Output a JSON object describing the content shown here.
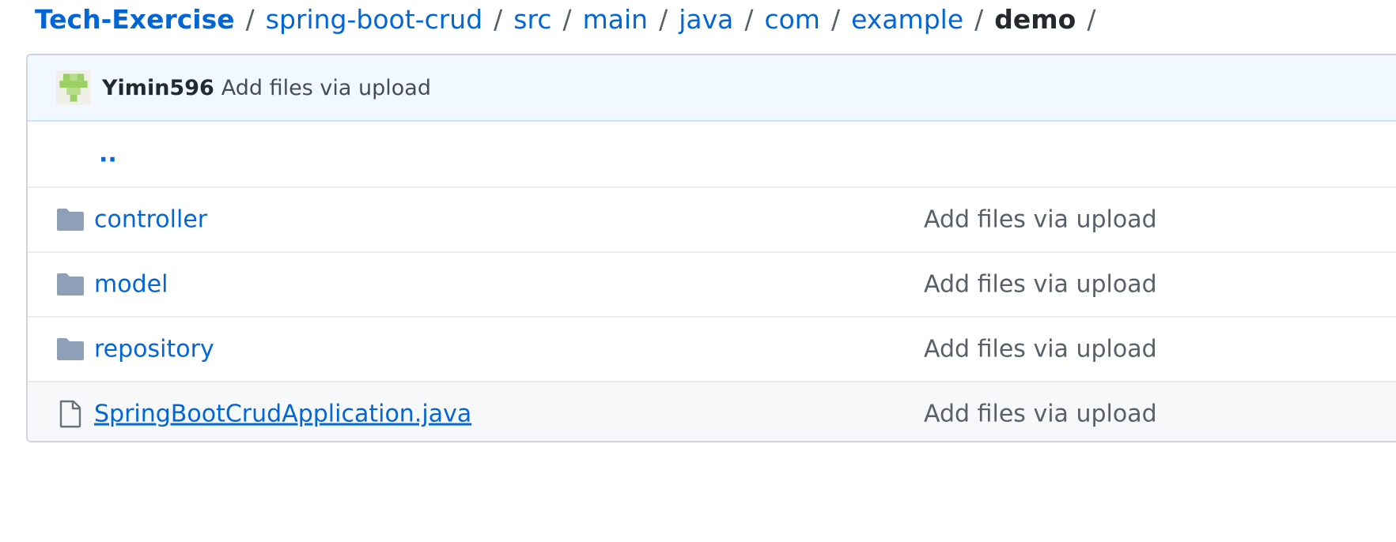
{
  "breadcrumb": {
    "root": "Tech-Exercise",
    "path": [
      "spring-boot-crud",
      "src",
      "main",
      "java",
      "com",
      "example"
    ],
    "current": "demo",
    "separator": "/"
  },
  "commit": {
    "author": "Yimin596",
    "message": "Add files via upload"
  },
  "parent_dir": "..",
  "files": [
    {
      "icon": "folder-icon",
      "name": "controller",
      "message": "Add files via upload"
    },
    {
      "icon": "folder-icon",
      "name": "model",
      "message": "Add files via upload"
    },
    {
      "icon": "folder-icon",
      "name": "repository",
      "message": "Add files via upload"
    },
    {
      "icon": "file-icon",
      "name": "SpringBootCrudApplication.java",
      "message": "Add files via upload"
    }
  ],
  "colors": {
    "link": "#0366d6",
    "folder_icon": "#79b8ff",
    "commit_bar_bg": "#f1f8ff",
    "avatar_green": "#9bd164"
  }
}
